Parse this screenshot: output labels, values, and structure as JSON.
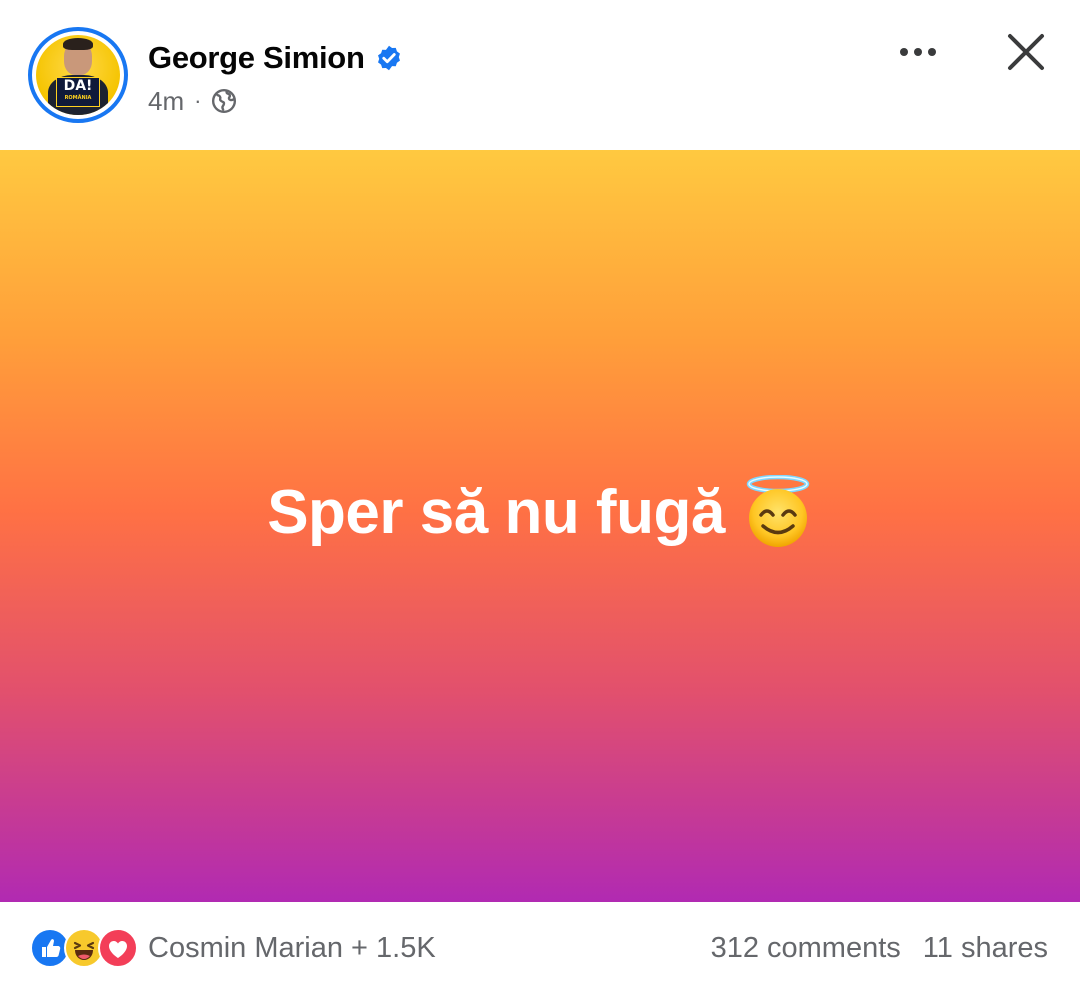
{
  "post_header": {
    "author_name": "George Simion",
    "time_ago": "4m",
    "separator": "·",
    "visibility_icon": "globe-icon",
    "verified_icon": "verified-badge-icon",
    "avatar_badge_text": "DA!",
    "avatar_badge_subtext": "ROMÂNIA"
  },
  "post": {
    "text": "Sper să nu fugă",
    "emoji_icon": "smiling-face-with-halo-icon",
    "background_colors": [
      "#ffc940",
      "#ff9f3a",
      "#ff7144",
      "#e2506d",
      "#b12ab2"
    ]
  },
  "footer": {
    "reaction_icons": [
      "like-icon",
      "haha-icon",
      "love-icon"
    ],
    "reactors": "Cosmin Marian + 1.5K",
    "comments": "312 comments",
    "shares": "11 shares"
  },
  "controls": {
    "more_icon": "more-horizontal-icon",
    "close_icon": "close-icon"
  },
  "colors": {
    "accent": "#1877f2",
    "secondary_text": "#65676b"
  }
}
